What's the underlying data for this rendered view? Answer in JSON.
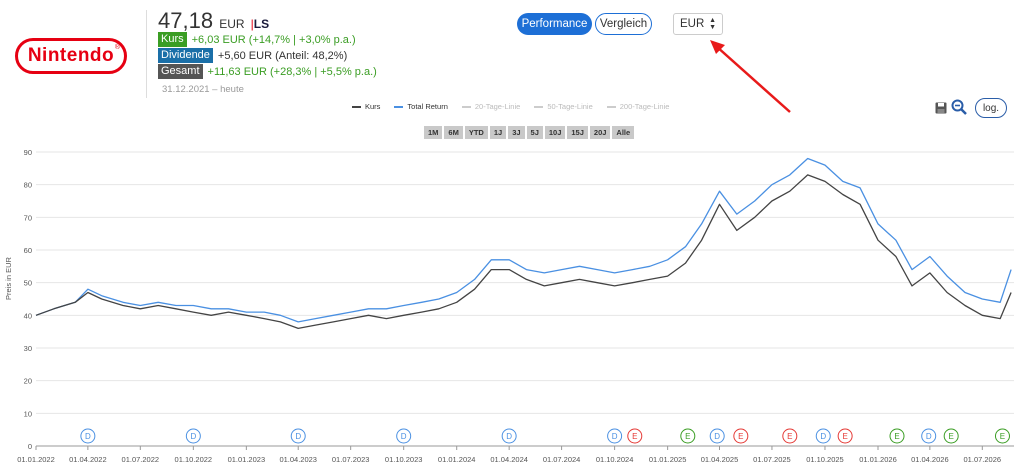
{
  "header": {
    "price_value": "47,18",
    "price_currency": "EUR",
    "separator": "|",
    "exchange": "LS",
    "kurs_label": "Kurs",
    "kurs_text": "+6,03 EUR (+14,7% | +3,0% p.a.)",
    "dividende_label": "Dividende",
    "dividende_text": "+5,60 EUR (Anteil: 48,2%)",
    "gesamt_label": "Gesamt",
    "gesamt_text": "+11,63 EUR (+28,3% | +5,5% p.a.)",
    "period_text": "31.12.2021 – heute",
    "logo_text": "Nintendo",
    "logo_mark": "®"
  },
  "controls": {
    "performance_label": "Performance",
    "vergleich_label": "Vergleich",
    "currency_value": "EUR",
    "log_label": "log."
  },
  "colors": {
    "kurs": "#444444",
    "total_return": "#4a90e2",
    "positive": "#3a9d23",
    "accent": "#1d6fd6",
    "brand": "#e60012",
    "arrow": "#e81a1a"
  },
  "ranges": [
    "1M",
    "6M",
    "YTD",
    "1J",
    "3J",
    "5J",
    "10J",
    "15J",
    "20J",
    "Alle"
  ],
  "chart_data": {
    "type": "line",
    "ylabel": "Preis in EUR",
    "ylim": [
      0,
      90
    ],
    "yticks": [
      0,
      10,
      20,
      30,
      40,
      50,
      60,
      70,
      80,
      90
    ],
    "xlim": [
      "2022-01-01",
      "2026-08-25"
    ],
    "xticks": [
      "01.01.2022",
      "01.04.2022",
      "01.07.2022",
      "01.10.2022",
      "01.01.2023",
      "01.04.2023",
      "01.07.2023",
      "01.10.2023",
      "01.01.2024",
      "01.04.2024",
      "01.07.2024",
      "01.10.2024",
      "01.01.2025",
      "01.04.2025",
      "01.07.2025",
      "01.10.2025",
      "01.01.2026",
      "01.04.2026",
      "01.07.2026"
    ],
    "legend": [
      {
        "name": "Kurs",
        "active": true
      },
      {
        "name": "Total Return",
        "active": true
      },
      {
        "name": "20-Tage-Linie",
        "active": false
      },
      {
        "name": "50-Tage-Linie",
        "active": false
      },
      {
        "name": "200-Tage-Linie",
        "active": false
      }
    ],
    "grid": true,
    "series": [
      {
        "name": "Kurs",
        "x": [
          "2022-01-01",
          "2022-02-01",
          "2022-03-10",
          "2022-04-01",
          "2022-04-25",
          "2022-06-01",
          "2022-07-01",
          "2022-08-01",
          "2022-09-01",
          "2022-10-01",
          "2022-11-01",
          "2022-12-01",
          "2023-01-01",
          "2023-02-01",
          "2023-03-01",
          "2023-04-01",
          "2023-05-01",
          "2023-06-01",
          "2023-07-01",
          "2023-08-01",
          "2023-09-01",
          "2023-10-01",
          "2023-11-01",
          "2023-12-01",
          "2024-01-01",
          "2024-02-01",
          "2024-03-01",
          "2024-04-01",
          "2024-05-01",
          "2024-06-01",
          "2024-07-01",
          "2024-08-01",
          "2024-09-01",
          "2024-10-01",
          "2024-11-01",
          "2024-12-01",
          "2025-01-01",
          "2025-02-01",
          "2025-03-01",
          "2025-04-01",
          "2025-05-01",
          "2025-06-01",
          "2025-07-01",
          "2025-08-01",
          "2025-09-01",
          "2025-10-01",
          "2025-11-01",
          "2025-12-01",
          "2026-01-01",
          "2026-02-01",
          "2026-03-01",
          "2026-04-01",
          "2026-05-01",
          "2026-06-01",
          "2026-07-01",
          "2026-08-01",
          "2026-08-20"
        ],
        "y": [
          40,
          42,
          44,
          47,
          45,
          43,
          42,
          43,
          42,
          41,
          40,
          41,
          40,
          39,
          38,
          36,
          37,
          38,
          39,
          40,
          39,
          40,
          41,
          42,
          44,
          48,
          54,
          54,
          51,
          49,
          50,
          51,
          50,
          49,
          50,
          51,
          52,
          56,
          63,
          74,
          66,
          70,
          75,
          78,
          83,
          81,
          77,
          74,
          63,
          58,
          49,
          53,
          47,
          43,
          40,
          39,
          47
        ]
      },
      {
        "name": "Total Return",
        "x": [
          "2022-01-01",
          "2022-02-01",
          "2022-03-10",
          "2022-04-01",
          "2022-04-25",
          "2022-06-01",
          "2022-07-01",
          "2022-08-01",
          "2022-09-01",
          "2022-10-01",
          "2022-11-01",
          "2022-12-01",
          "2023-01-01",
          "2023-02-01",
          "2023-03-01",
          "2023-04-01",
          "2023-05-01",
          "2023-06-01",
          "2023-07-01",
          "2023-08-01",
          "2023-09-01",
          "2023-10-01",
          "2023-11-01",
          "2023-12-01",
          "2024-01-01",
          "2024-02-01",
          "2024-03-01",
          "2024-04-01",
          "2024-05-01",
          "2024-06-01",
          "2024-07-01",
          "2024-08-01",
          "2024-09-01",
          "2024-10-01",
          "2024-11-01",
          "2024-12-01",
          "2025-01-01",
          "2025-02-01",
          "2025-03-01",
          "2025-04-01",
          "2025-05-01",
          "2025-06-01",
          "2025-07-01",
          "2025-08-01",
          "2025-09-01",
          "2025-10-01",
          "2025-11-01",
          "2025-12-01",
          "2026-01-01",
          "2026-02-01",
          "2026-03-01",
          "2026-04-01",
          "2026-05-01",
          "2026-06-01",
          "2026-07-01",
          "2026-08-01",
          "2026-08-20"
        ],
        "y": [
          40,
          42,
          44,
          48,
          46,
          44,
          43,
          44,
          43,
          43,
          42,
          42,
          41,
          41,
          40,
          38,
          39,
          40,
          41,
          42,
          42,
          43,
          44,
          45,
          47,
          51,
          57,
          57,
          54,
          53,
          54,
          55,
          54,
          53,
          54,
          55,
          57,
          61,
          68,
          78,
          71,
          75,
          80,
          83,
          88,
          86,
          81,
          79,
          68,
          63,
          54,
          58,
          52,
          47,
          45,
          44,
          54
        ]
      }
    ],
    "events": [
      {
        "type": "D",
        "date": "2022-04-01"
      },
      {
        "type": "D",
        "date": "2022-10-01"
      },
      {
        "type": "D",
        "date": "2023-04-01"
      },
      {
        "type": "D",
        "date": "2023-10-01"
      },
      {
        "type": "D",
        "date": "2024-04-01"
      },
      {
        "type": "D",
        "date": "2024-10-01"
      },
      {
        "type": "E",
        "date": "2024-11-05"
      },
      {
        "type": "E",
        "date": "2025-02-05"
      },
      {
        "type": "D",
        "date": "2025-03-28"
      },
      {
        "type": "E",
        "date": "2025-05-08"
      },
      {
        "type": "E",
        "date": "2025-08-01"
      },
      {
        "type": "D",
        "date": "2025-09-28"
      },
      {
        "type": "E",
        "date": "2025-11-05"
      },
      {
        "type": "E",
        "date": "2026-02-03"
      },
      {
        "type": "D",
        "date": "2026-03-30"
      },
      {
        "type": "E",
        "date": "2026-05-08"
      },
      {
        "type": "E",
        "date": "2026-08-05"
      }
    ]
  }
}
